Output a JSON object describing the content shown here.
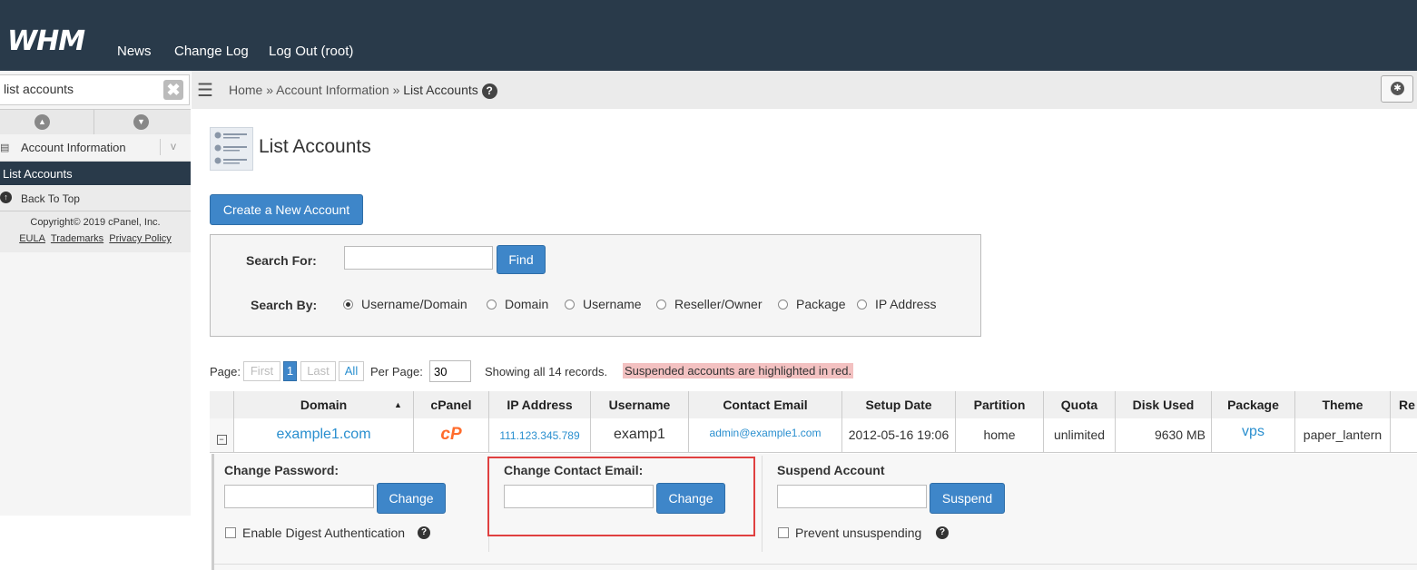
{
  "header": {
    "logo": "WHM",
    "nav": [
      "News",
      "Change Log",
      "Log Out (root)"
    ]
  },
  "sidebar": {
    "search_value": "list accounts",
    "section": "Account Information",
    "section_chevron": "v",
    "active_item": "List Accounts",
    "back_to_top": "Back To Top",
    "copyright": "Copyright© 2019 cPanel, Inc.",
    "links": [
      "EULA",
      "Trademarks",
      "Privacy Policy"
    ]
  },
  "breadcrumb": {
    "items": [
      "Home",
      "Account Information",
      "List Accounts"
    ],
    "separator": "»"
  },
  "page": {
    "title": "List Accounts",
    "create_button": "Create a New Account"
  },
  "search": {
    "search_for_label": "Search For:",
    "search_for_value": "",
    "find_button": "Find",
    "search_by_label": "Search By:",
    "options": [
      "Username/Domain",
      "Domain",
      "Username",
      "Reseller/Owner",
      "Package",
      "IP Address"
    ],
    "selected": "Username/Domain"
  },
  "pagination": {
    "page_label": "Page:",
    "first": "First",
    "current": "1",
    "last": "Last",
    "all": "All",
    "per_page_label": "Per Page:",
    "per_page_value": "30",
    "showing": "Showing all 14 records.",
    "suspended_note": "Suspended accounts are highlighted in red."
  },
  "table": {
    "columns": [
      "Domain",
      "cPanel",
      "IP Address",
      "Username",
      "Contact Email",
      "Setup Date",
      "Partition",
      "Quota",
      "Disk Used",
      "Package",
      "Theme",
      "Re"
    ],
    "row": {
      "toggle": "−",
      "domain": "example1.com",
      "cpanel_icon": "cP",
      "ip": "111.123.345.789",
      "username": "examp1",
      "email": "admin@example1.com",
      "setup_date": "2012-05-16 19:06",
      "partition": "home",
      "quota": "unlimited",
      "disk_used": "9630 MB",
      "package": "vps",
      "theme": "paper_lantern"
    }
  },
  "expanded": {
    "change_password_label": "Change Password:",
    "change_password_button": "Change",
    "digest_label": "Enable Digest Authentication",
    "change_email_label": "Change Contact Email:",
    "change_email_button": "Change",
    "suspend_label": "Suspend Account",
    "suspend_button": "Suspend",
    "prevent_label": "Prevent unsuspending"
  },
  "colors": {
    "topbar": "#293a4a",
    "button": "#3e86c9",
    "link": "#2a8fcf",
    "highlight_red": "#f3c1c1",
    "callout_red": "#e04040"
  }
}
